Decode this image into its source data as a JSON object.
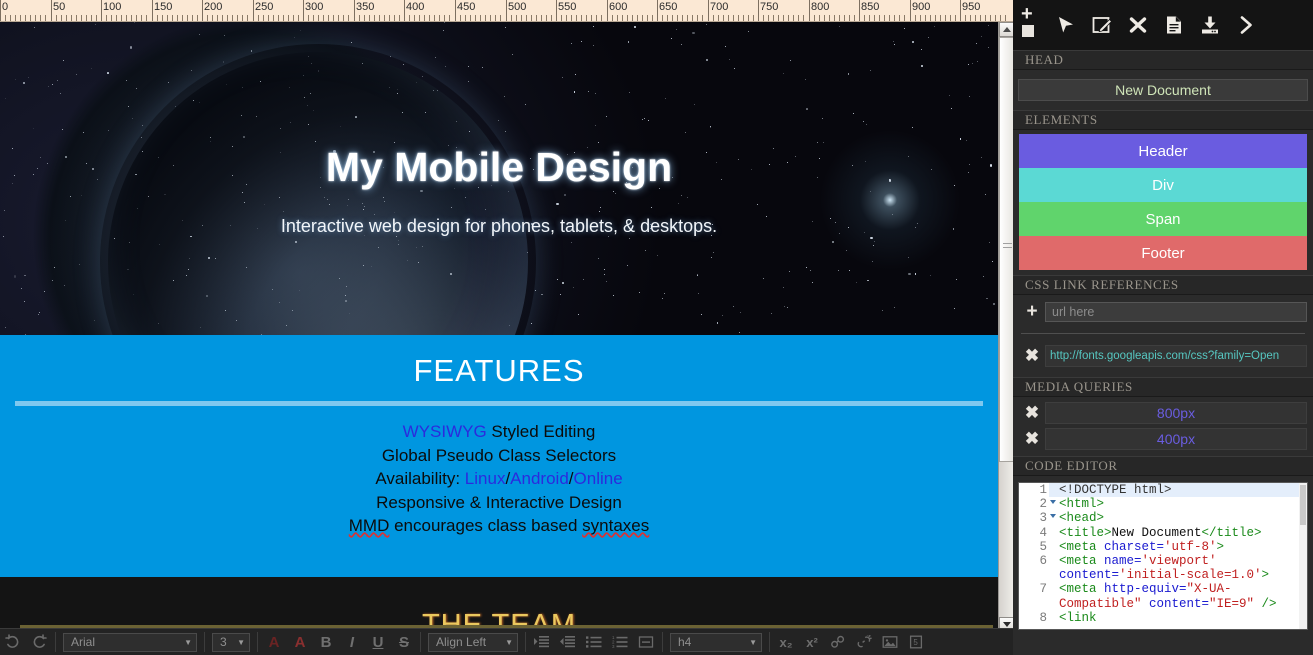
{
  "ruler": {
    "unit_step": 50,
    "labels": [
      "0",
      "50",
      "100",
      "150",
      "200",
      "250",
      "300",
      "350",
      "400",
      "450",
      "500",
      "550",
      "600",
      "650",
      "700",
      "750",
      "800",
      "850",
      "900",
      "950"
    ]
  },
  "canvas": {
    "hero": {
      "title": "My Mobile Design",
      "subtitle": "Interactive web design for phones, tablets, & desktops."
    },
    "features": {
      "heading": "FEATURES",
      "lines": [
        {
          "parts": [
            {
              "text": "WYSIWYG",
              "style": "link"
            },
            {
              "text": " Styled Editing",
              "style": "plain"
            }
          ]
        },
        {
          "parts": [
            {
              "text": "Global Pseudo Class Selectors",
              "style": "plain"
            }
          ]
        },
        {
          "parts": [
            {
              "text": "Availability: ",
              "style": "plain"
            },
            {
              "text": "Linux",
              "style": "link"
            },
            {
              "text": "/",
              "style": "plain"
            },
            {
              "text": "Android",
              "style": "link"
            },
            {
              "text": "/",
              "style": "plain"
            },
            {
              "text": "Online",
              "style": "link"
            }
          ]
        },
        {
          "parts": [
            {
              "text": "Responsive & Interactive Design",
              "style": "plain"
            }
          ]
        },
        {
          "parts": [
            {
              "text": "MMD",
              "style": "spell"
            },
            {
              "text": " encourages class based ",
              "style": "plain"
            },
            {
              "text": "syntaxes",
              "style": "spell"
            }
          ]
        }
      ]
    },
    "team": {
      "heading": "THE TEAM"
    }
  },
  "bottom_toolbar": {
    "undo_icon": "undo-icon",
    "redo_icon": "redo-icon",
    "font_family_value": "Arial",
    "font_size_value": "3",
    "fore_color_icon": "text-color-A",
    "back_color_icon": "highlight-color-A",
    "bold_label": "B",
    "italic_label": "I",
    "underline_label": "U",
    "strike_label": "S",
    "align_value": "Align Left",
    "indent_icon": "indent-increase-icon",
    "outdent_icon": "indent-decrease-icon",
    "ul_icon": "unordered-list-icon",
    "ol_icon": "ordered-list-icon",
    "hr_icon": "horizontal-rule-icon",
    "tag_value": "h4",
    "subscript_label": "x₂",
    "superscript_label": "x²",
    "link_icon": "link-icon",
    "unlink_icon": "unlink-icon",
    "image_icon": "image-icon",
    "html5_icon": "html5-icon"
  },
  "panel": {
    "toolbar_icons": [
      {
        "name": "add-element-icon",
        "glyph": "+"
      },
      {
        "name": "select-pointer-icon"
      },
      {
        "name": "edit-pencil-icon"
      },
      {
        "name": "delete-close-icon"
      },
      {
        "name": "new-document-icon"
      },
      {
        "name": "save-download-icon"
      },
      {
        "name": "expand-chevron-icon"
      }
    ],
    "head": {
      "section_label": "HEAD",
      "document_title": "New Document"
    },
    "elements": {
      "section_label": "ELEMENTS",
      "items": [
        {
          "label": "Header",
          "color": "#6a5ce0"
        },
        {
          "label": "Div",
          "color": "#5bd9d4"
        },
        {
          "label": "Span",
          "color": "#60d46c"
        },
        {
          "label": "Footer",
          "color": "#e06a6a"
        }
      ]
    },
    "css_links": {
      "section_label": "CSS LINK REFERENCES",
      "add_glyph": "+",
      "url_placeholder": "url here",
      "entries": [
        {
          "remove_glyph": "✖",
          "url": "http://fonts.googleapis.com/css?family=Open"
        }
      ]
    },
    "media_queries": {
      "section_label": "MEDIA QUERIES",
      "items": [
        {
          "remove_glyph": "✖",
          "value": "800px"
        },
        {
          "remove_glyph": "✖",
          "value": "400px"
        }
      ]
    },
    "code_editor": {
      "section_label": "CODE EDITOR",
      "lines": [
        {
          "num": "1",
          "fold": false,
          "highlight": true,
          "tokens": [
            {
              "t": "doc",
              "v": "<!DOCTYPE html>"
            }
          ]
        },
        {
          "num": "2",
          "fold": true,
          "highlight": false,
          "tokens": [
            {
              "t": "tag",
              "v": "<html>"
            }
          ]
        },
        {
          "num": "3",
          "fold": true,
          "highlight": false,
          "tokens": [
            {
              "t": "tag",
              "v": "<head>"
            }
          ]
        },
        {
          "num": "4",
          "fold": false,
          "highlight": false,
          "tokens": [
            {
              "t": "tag",
              "v": "<title>"
            },
            {
              "t": "txt",
              "v": "New Document"
            },
            {
              "t": "tag",
              "v": "</title>"
            }
          ]
        },
        {
          "num": "5",
          "fold": false,
          "highlight": false,
          "tokens": [
            {
              "t": "tag",
              "v": "<meta "
            },
            {
              "t": "attr",
              "v": "charset="
            },
            {
              "t": "val",
              "v": "'utf-8'"
            },
            {
              "t": "tag",
              "v": ">"
            }
          ]
        },
        {
          "num": "6",
          "fold": false,
          "highlight": false,
          "tokens": [
            {
              "t": "tag",
              "v": "<meta "
            },
            {
              "t": "attr",
              "v": "name="
            },
            {
              "t": "val",
              "v": "'viewport' "
            },
            {
              "t": "attr",
              "v": "content="
            },
            {
              "t": "val",
              "v": "'initial-scale=1.0'"
            },
            {
              "t": "tag",
              "v": ">"
            }
          ]
        },
        {
          "num": "7",
          "fold": false,
          "highlight": false,
          "tokens": [
            {
              "t": "tag",
              "v": "<meta "
            },
            {
              "t": "attr",
              "v": "http-equiv="
            },
            {
              "t": "val",
              "v": "\"X-UA-Compatible\" "
            },
            {
              "t": "attr",
              "v": "content="
            },
            {
              "t": "val",
              "v": "\"IE=9\" "
            },
            {
              "t": "tag",
              "v": "/>"
            }
          ]
        },
        {
          "num": "8",
          "fold": false,
          "highlight": false,
          "tokens": [
            {
              "t": "tag",
              "v": "<link"
            }
          ]
        }
      ]
    }
  },
  "colors": {
    "features_bg": "#0096e0",
    "features_rule": "#7fc8ef",
    "team_text": "#ebc85e",
    "panel_bg": "#2b2b2b",
    "panel_toolbar_bg": "#141414",
    "ruler_bg": "#fbe8d4",
    "link_blue": "#2b2bdd",
    "css_url_text": "#56c7c1",
    "media_query_text": "#6a5de0",
    "doc_title_text": "#cfe4b8"
  }
}
